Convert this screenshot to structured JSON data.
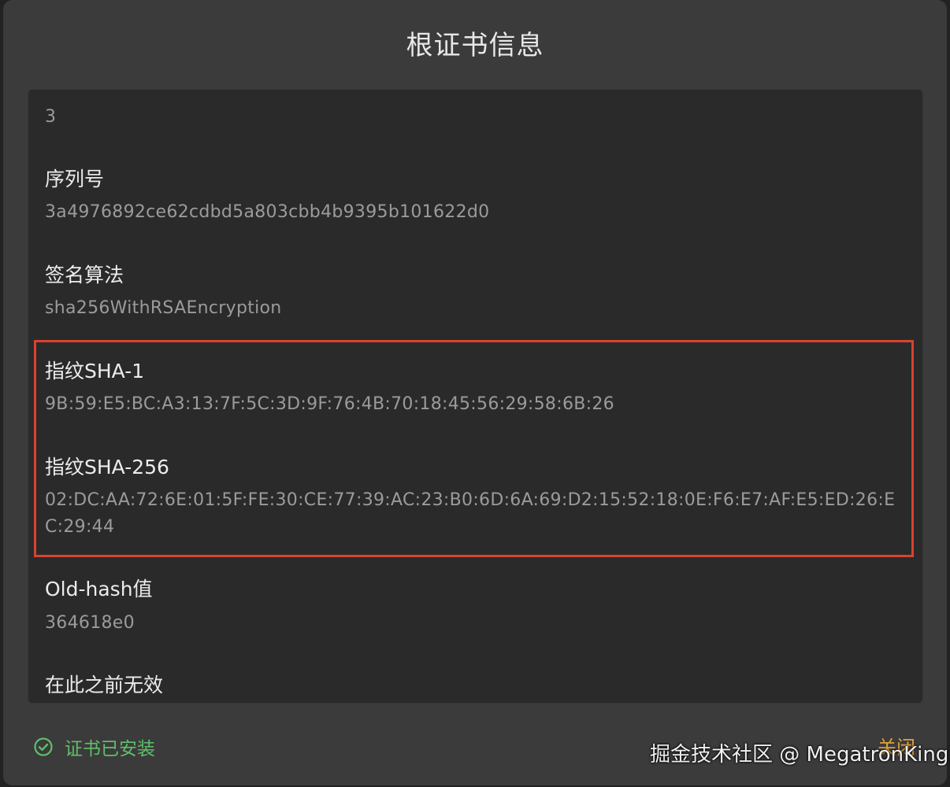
{
  "dialog": {
    "title": "根证书信息",
    "fields": {
      "version_value": "3",
      "serial_label": "序列号",
      "serial_value": "3a4976892ce62cdbd5a803cbb4b9395b101622d0",
      "sigalg_label": "签名算法",
      "sigalg_value": "sha256WithRSAEncryption",
      "sha1_label": "指纹SHA-1",
      "sha1_value": "9B:59:E5:BC:A3:13:7F:5C:3D:9F:76:4B:70:18:45:56:29:58:6B:26",
      "sha256_label": "指纹SHA-256",
      "sha256_value": "02:DC:AA:72:6E:01:5F:FE:30:CE:77:39:AC:23:B0:6D:6A:69:D2:15:52:18:0E:F6:E7:AF:E5:ED:26:EC:29:44",
      "oldhash_label": "Old-hash值",
      "oldhash_value": "364618e0",
      "notbefore_label": "在此之前无效"
    },
    "status_text": "证书已安装",
    "close_label": "关闭"
  },
  "watermark": "掘金技术社区 @ MegatronKing",
  "colors": {
    "highlight_border": "#d9432f",
    "status_green": "#5fbf6a",
    "close_orange": "#e0a33a"
  },
  "icons": {
    "status": "check-circle-icon"
  }
}
